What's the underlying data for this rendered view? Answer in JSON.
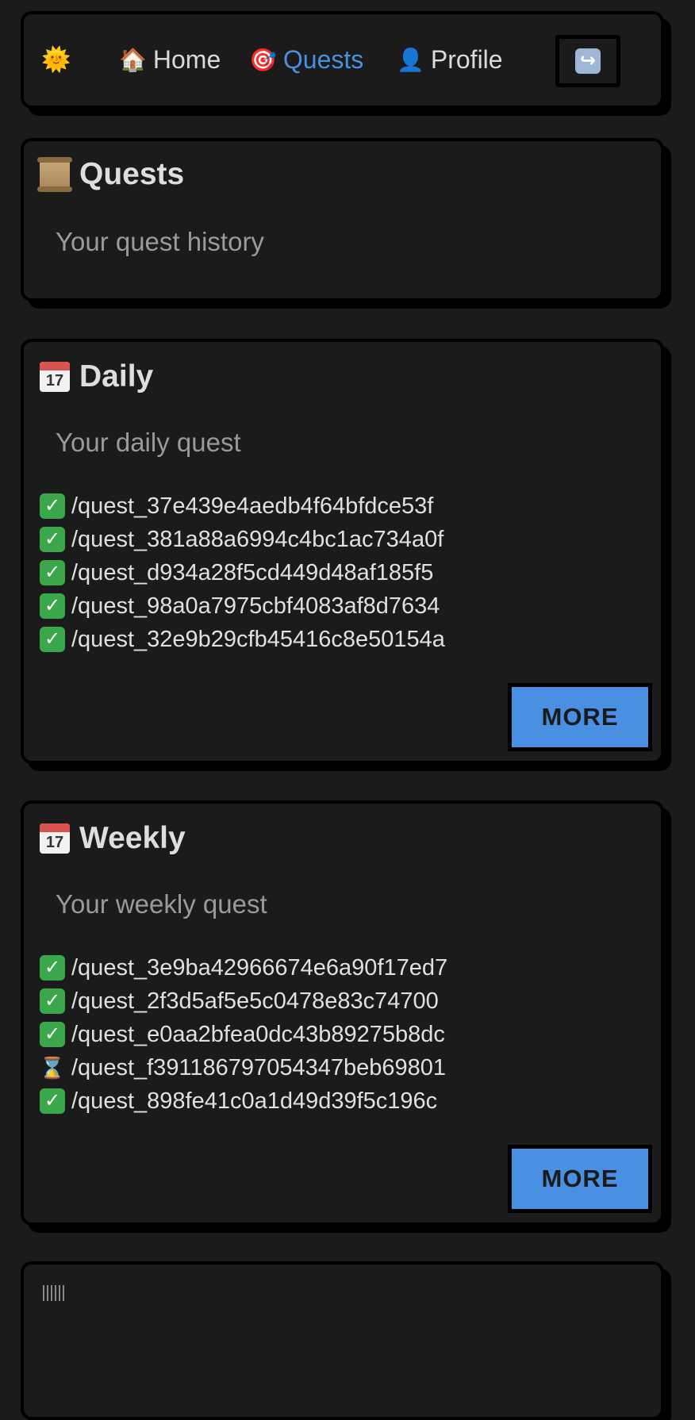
{
  "nav": {
    "theme_icon": "sun-icon",
    "items": [
      {
        "icon": "house-icon",
        "glyph": "🏠",
        "label": "Home"
      },
      {
        "icon": "target-icon",
        "glyph": "🎯",
        "label": "Quests"
      },
      {
        "icon": "person-icon",
        "glyph": "👤",
        "label": "Profile"
      }
    ],
    "active": "Quests",
    "logout_icon": "return-arrow-icon",
    "logout_glyph": "↪"
  },
  "quests_card": {
    "icon": "scroll-icon",
    "title": "Quests",
    "subtitle": "Your quest history"
  },
  "daily": {
    "icon": "calendar-icon",
    "title": "Daily",
    "subtitle": "Your daily quest",
    "quests": [
      {
        "status": "done",
        "name": "/quest_37e439e4aedb4f64bfdce53f"
      },
      {
        "status": "done",
        "name": "/quest_381a88a6994c4bc1ac734a0f"
      },
      {
        "status": "done",
        "name": "/quest_d934a28f5cd449d48af185f5"
      },
      {
        "status": "done",
        "name": "/quest_98a0a7975cbf4083af8d7634"
      },
      {
        "status": "done",
        "name": "/quest_32e9b29cfb45416c8e50154a"
      }
    ],
    "more_label": "MORE"
  },
  "weekly": {
    "icon": "calendar-icon",
    "title": "Weekly",
    "subtitle": "Your weekly quest",
    "quests": [
      {
        "status": "done",
        "name": "/quest_3e9ba42966674e6a90f17ed7"
      },
      {
        "status": "done",
        "name": "/quest_2f3d5af5e5c0478e83c74700"
      },
      {
        "status": "done",
        "name": "/quest_e0aa2bfea0dc43b89275b8dc"
      },
      {
        "status": "pending",
        "name": "/quest_f391186797054347beb69801"
      },
      {
        "status": "done",
        "name": "/quest_898fe41c0a1d49d39f5c196c"
      }
    ],
    "more_label": "MORE"
  },
  "calendar_day": "17",
  "calendar_month": "JUL",
  "colors": {
    "background": "#1b1b1b",
    "accent": "#4a90e2",
    "done": "#3aa84a"
  }
}
